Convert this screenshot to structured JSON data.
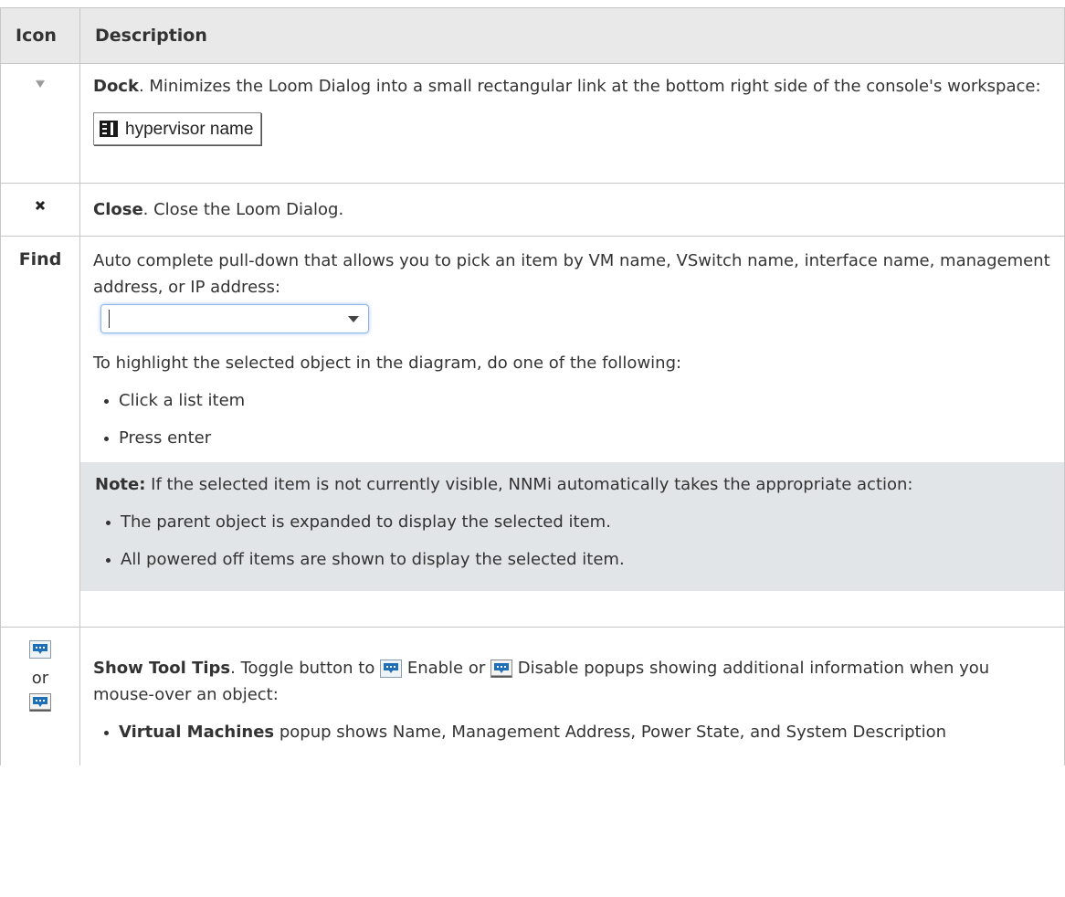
{
  "table": {
    "headers": {
      "icon": "Icon",
      "description": "Description"
    },
    "rows": {
      "dock": {
        "icon_name": "dock-triangle-icon",
        "title": "Dock",
        "text": ". Minimizes the Loom Dialog into a small rectangular link at the bottom right side of the console's workspace:",
        "sample_label": "hypervisor name"
      },
      "close": {
        "icon_name": "close-x-icon",
        "title": "Close",
        "text": ". Close the Loom Dialog."
      },
      "find": {
        "icon_label": "Find",
        "text": "Auto complete pull-down that allows you to pick an item by VM name, VSwitch name, interface name, management address, or IP address:",
        "highlight_text": "To highlight the selected object in the diagram, do one of the following:",
        "bullets": [
          "Click a list item",
          "Press enter"
        ],
        "note": {
          "label": "Note:",
          "text": " If the selected item is not currently visible, NNMi automatically takes the appropriate action:",
          "bullets": [
            "The parent object is expanded to display the selected item.",
            "All powered off items are shown to display the selected item."
          ]
        }
      },
      "tooltips": {
        "icon_name": "tooltip-toggle-icon",
        "or_text": "or",
        "title": "Show Tool Tips",
        "text_1": ". Toggle button to ",
        "enable_text": " Enable or ",
        "disable_text": " Disable popups showing additional information when you mouse-over an object:",
        "bullet_title": "Virtual Machines",
        "bullet_text": " popup shows Name, Management Address, Power State, and System Description"
      }
    }
  }
}
